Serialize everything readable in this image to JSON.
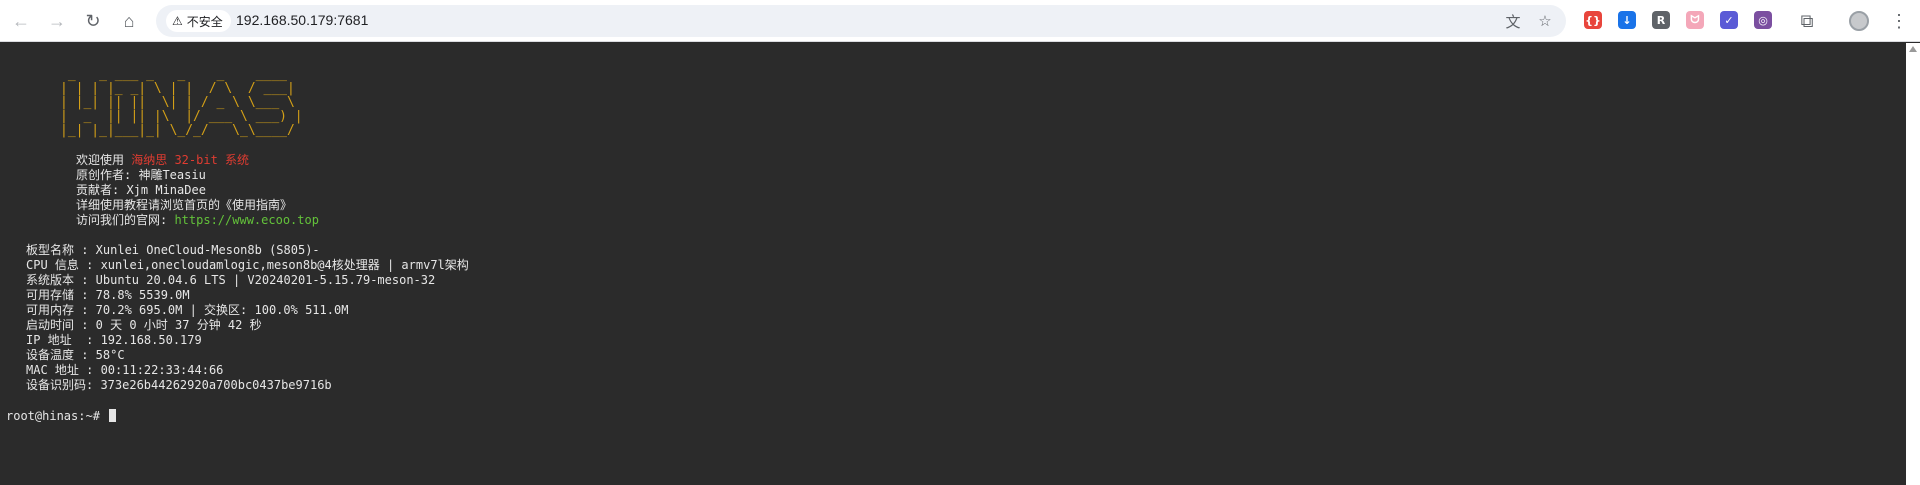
{
  "browser": {
    "security_label": "不安全",
    "url": "192.168.50.179:7681",
    "extensions": [
      {
        "name": "json-extension",
        "glyph": "{}",
        "color": "#e8453c"
      },
      {
        "name": "downloader-extension",
        "glyph": "↓",
        "color": "#1a73e8"
      },
      {
        "name": "r-extension",
        "glyph": "R",
        "color": "#5f6368"
      },
      {
        "name": "bilibili-extension",
        "glyph": "ᗢ",
        "color": "#f4a7b9"
      },
      {
        "name": "translate-extension",
        "glyph": "✓",
        "color": "#5b5bd6"
      },
      {
        "name": "settings-extension",
        "glyph": "◎",
        "color": "#7b4fa0"
      }
    ]
  },
  "terminal": {
    "logo_lines": [
      " _   _ ___ _   _    _    ____  ",
      "| | | |_ _| \\ | |  / \\  / ___| ",
      "| |_| || ||  \\| | / _ \\ \\___ \\ ",
      "|  _  || || |\\  |/ ___ \\ ___) |",
      "|_| |_|___|_| \\_/_/   \\_\\____/ "
    ],
    "welcome": {
      "prefix": "欢迎使用 ",
      "highlight": "海纳思 32-bit 系统",
      "author": "原创作者: 神雕Teasiu",
      "contributor": "贡献者: Xjm MinaDee",
      "guide": "详细使用教程请浏览首页的《使用指南》",
      "site_prefix": "访问我们的官网: ",
      "site_url": "https://www.ecoo.top"
    },
    "sysinfo": [
      "板型名称 : Xunlei OneCloud-Meson8b (S805)-",
      "CPU 信息 : xunlei,onecloudamlogic,meson8b@4核处理器 | armv7l架构",
      "系统版本 : Ubuntu 20.04.6 LTS | V20240201-5.15.79-meson-32",
      "可用存储 : 78.8% 5539.0M",
      "可用内存 : 70.2% 695.0M | 交换区: 100.0% 511.0M",
      "启动时间 : 0 天 0 小时 37 分钟 42 秒",
      "IP 地址  : 192.168.50.179",
      "设备温度 : 58°C",
      "MAC 地址 : 00:11:22:33:44:66",
      "设备识别码: 373e26b44262920a700bc0437be9716b"
    ],
    "prompt": "root@hinas:~# "
  }
}
